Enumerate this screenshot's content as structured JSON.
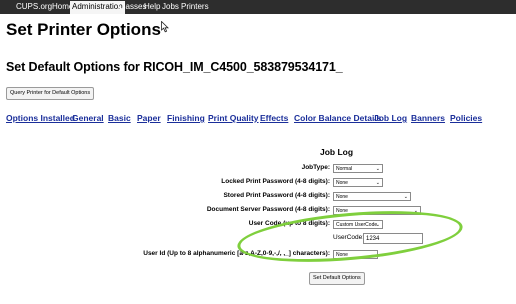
{
  "topnav": {
    "items": [
      "CUPS.org",
      "Home",
      "Administration",
      "Classes",
      "Help",
      "Jobs",
      "Printers"
    ],
    "active": "Administration"
  },
  "page_title": "Set Printer Options",
  "sub_title": "Set Default Options for RICOH_IM_C4500_583879534171_",
  "query_button": "Query Printer for Default Options",
  "tabs": [
    "Options Installed",
    "General",
    "Basic",
    "Paper",
    "Finishing",
    "Print Quality",
    "Effects",
    "Color Balance Details",
    "Job Log",
    "Banners",
    "Policies"
  ],
  "section_title": "Job Log",
  "rows": [
    {
      "label": "JobType:",
      "value": "Normal"
    },
    {
      "label": "Locked Print Password (4-8 digits):",
      "value": "None"
    },
    {
      "label": "Stored Print Password (4-8 digits):",
      "value": "None"
    },
    {
      "label": "Document Server Password (4-8 digits):",
      "value": "None"
    },
    {
      "label": "User Code (up to 8 digits):",
      "value": "Custom UserCode"
    },
    {
      "label": "User Id (Up to 8 alphanumeric [a-z,A-Z,0-9,-,/,  ,_] characters):",
      "value": "None"
    }
  ],
  "usercode": {
    "label": "UserCode:",
    "value": "1234"
  },
  "submit_button": "Set Default Options",
  "colors": {
    "nav_bg": "#2d2d2d",
    "link": "#1a2e9a",
    "highlight": "#7fcf3d"
  }
}
